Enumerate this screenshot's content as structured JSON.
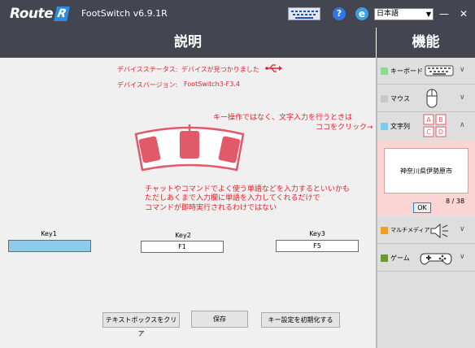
{
  "titlebar": {
    "logo_text": "Route",
    "logo_badge": "R",
    "app_title": "FootSwitch v6.9.1R",
    "help_glyph": "?",
    "ie_glyph": "e",
    "language": "日本語",
    "language_arrow": "▼",
    "minimize": "—",
    "close": "✕"
  },
  "headers": {
    "left": "説明",
    "right": "機能"
  },
  "status": {
    "device_status_label": "デバイスステータス:",
    "device_status_value": "デバイスが見つかりました",
    "device_version_label": "デバイスバージョン:",
    "device_version_value": "FootSwitch3-F3.4"
  },
  "annotations": {
    "top_line1": "キー操作ではなく、文字入力を行うときは",
    "top_line2": "ココをクリック→",
    "middle_line1": "チャットやコマンドでよく使う単語などを入力するといいかも",
    "middle_line2": "ただしあくまで入力欄に単語を入力してくれるだけで",
    "middle_line3": "コマンドが即時実行されるわけではない"
  },
  "keys": [
    {
      "label": "Key1",
      "value": ""
    },
    {
      "label": "Key2",
      "value": "F1"
    },
    {
      "label": "Key3",
      "value": "F5"
    }
  ],
  "buttons": {
    "clear": "テキストボックスをクリア",
    "save": "保存",
    "reset": "キー設定を初期化する"
  },
  "sidebar": {
    "keyboard": "キーボード",
    "mouse": "マウス",
    "text": "文字列",
    "text_icon_letters": [
      "A",
      "B",
      "C",
      "D"
    ],
    "multimedia": "マルチメディア",
    "game": "ゲーム",
    "chevron_down": "∨",
    "chevron_up": "∧",
    "text_value": "神奈川県伊勢原市",
    "counter": "8 / 38",
    "ok": "OK"
  },
  "colors": {
    "titlebar": "#434551",
    "accent_red": "#e5202a",
    "keyboard_swatch": "#8fd88f",
    "mouse_swatch": "#c8c8c8",
    "text_swatch": "#7ecbe9",
    "multimedia_swatch": "#f0a020",
    "game_swatch": "#6a9a2a",
    "pedal": "#e05a6a",
    "key_active": "#8fcbe9"
  }
}
